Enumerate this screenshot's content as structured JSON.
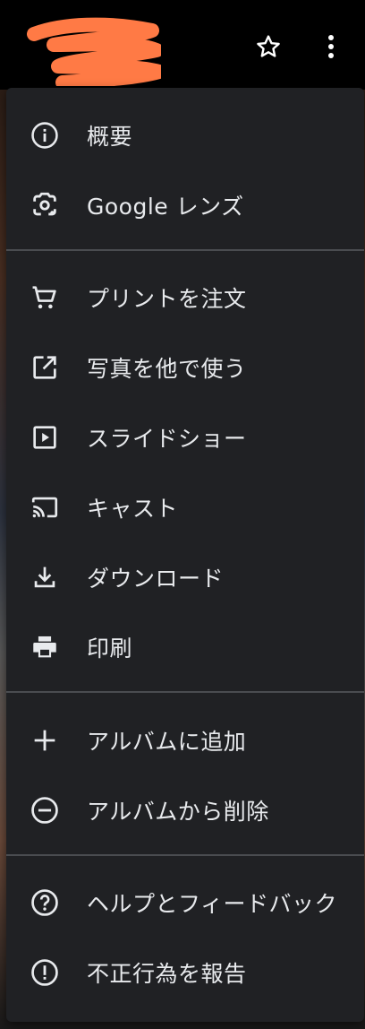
{
  "colors": {
    "menu_background": "#202124",
    "text": "#e8eaed",
    "icon": "#e8eaed",
    "divider": "#4a4c50",
    "redaction": "#ff7a45"
  },
  "topbar": {
    "icons": [
      "star-icon",
      "more-vert-icon"
    ]
  },
  "menu": {
    "items": [
      {
        "label": "概要",
        "icon": "info-icon"
      },
      {
        "label": "Google レンズ",
        "icon": "google-lens-icon"
      },
      {
        "label": "プリントを注文",
        "icon": "cart-icon"
      },
      {
        "label": "写真を他で使う",
        "icon": "open-external-icon"
      },
      {
        "label": "スライドショー",
        "icon": "slideshow-icon"
      },
      {
        "label": "キャスト",
        "icon": "cast-icon"
      },
      {
        "label": "ダウンロード",
        "icon": "download-icon"
      },
      {
        "label": "印刷",
        "icon": "print-icon"
      },
      {
        "label": "アルバムに追加",
        "icon": "plus-icon"
      },
      {
        "label": "アルバムから削除",
        "icon": "remove-circle-icon"
      },
      {
        "label": "ヘルプとフィードバック",
        "icon": "help-icon"
      },
      {
        "label": "不正行為を報告",
        "icon": "report-icon"
      }
    ]
  }
}
